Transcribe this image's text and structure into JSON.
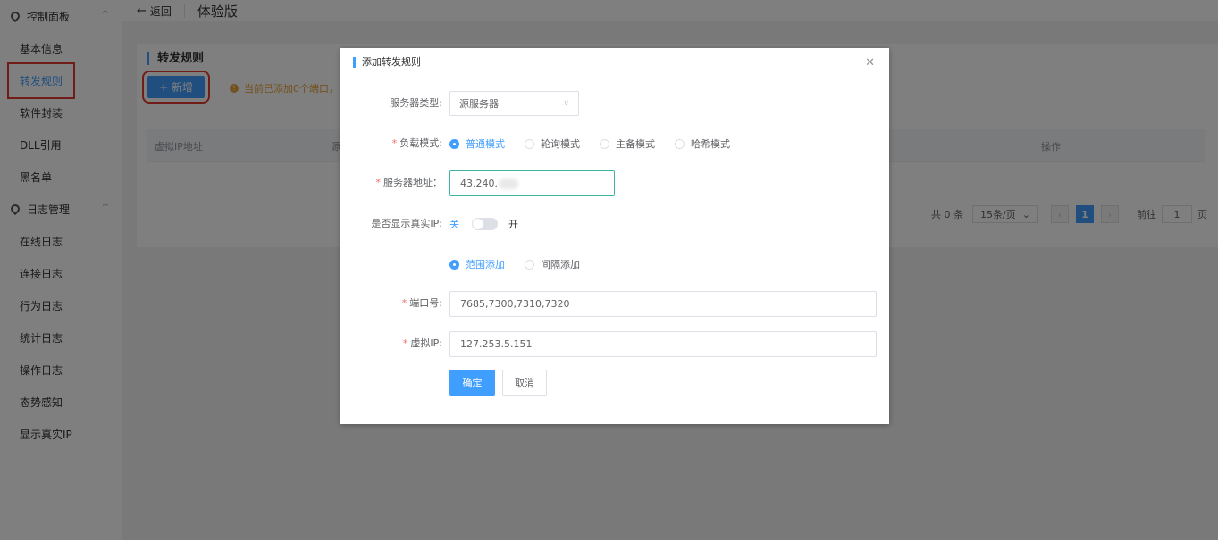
{
  "sidebar": {
    "group1": "控制面板",
    "items1": [
      "基本信息",
      "转发规则",
      "软件封装",
      "DLL引用",
      "黑名单"
    ],
    "group2": "日志管理",
    "items2": [
      "在线日志",
      "连接日志",
      "行为日志",
      "统计日志",
      "操作日志",
      "态势感知",
      "显示真实IP"
    ]
  },
  "topbar": {
    "back": "返回",
    "title": "体验版"
  },
  "card": {
    "title": "转发规则",
    "add_button": "+ 新增",
    "warning": "当前已添加0个端口，总计",
    "columns": {
      "virtual_ip": "虚拟IP地址",
      "source": "源",
      "op": "操作"
    },
    "pager": {
      "total": "共 0 条",
      "page_size": "15条/页",
      "current": "1",
      "goto": "前往",
      "goto_value": "1",
      "page_unit": "页"
    }
  },
  "dialog": {
    "title": "添加转发规则",
    "server_type_label": "服务器类型:",
    "server_type_value": "源服务器",
    "load_mode_label": "负载模式:",
    "load_modes": [
      "普通模式",
      "轮询模式",
      "主备模式",
      "哈希模式"
    ],
    "load_mode_selected": 0,
    "server_addr_label": "服务器地址：",
    "server_addr_value": "43.240.",
    "show_ip_label": "是否显示真实IP:",
    "switch_off": "关",
    "switch_on": "开",
    "add_modes": [
      "范围添加",
      "间隔添加"
    ],
    "add_mode_selected": 0,
    "port_label": "端口号:",
    "port_value": "7685,7300,7310,7320",
    "vip_label": "虚拟IP:",
    "vip_value": "127.253.5.151",
    "ok": "确定",
    "cancel": "取消"
  }
}
